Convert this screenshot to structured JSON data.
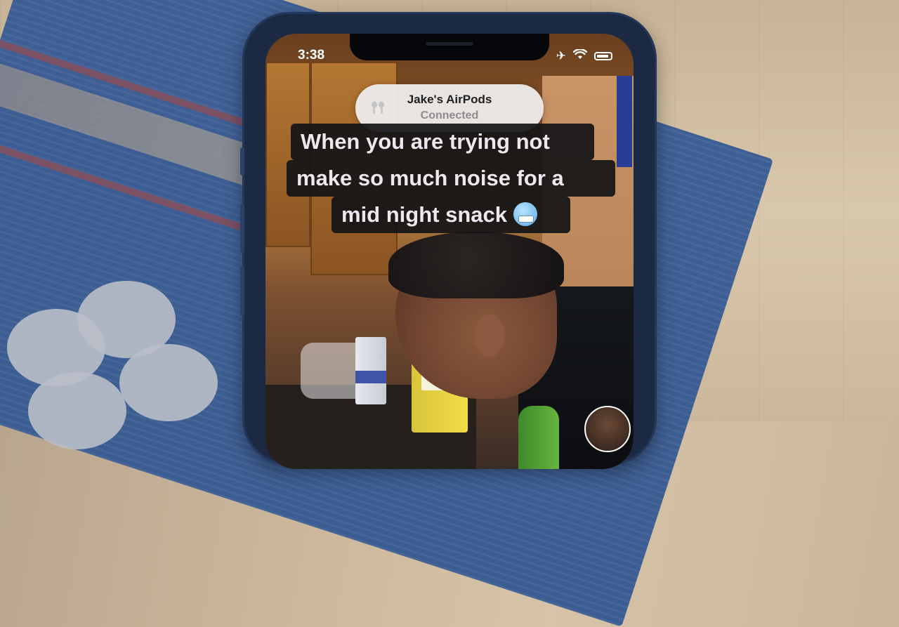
{
  "status_bar": {
    "time": "3:38",
    "icons": [
      "airplane-icon",
      "wifi-icon",
      "battery-icon"
    ]
  },
  "airpods_banner": {
    "device_name": "Jake's AirPods",
    "status": "Connected",
    "icon": "airpods-icon"
  },
  "caption": {
    "lines": [
      "When you are trying not",
      "make so much noise for a",
      "mid night snack"
    ],
    "emoji": "cold-face-emoji"
  },
  "colors": {
    "phone_frame": "#1b2a42",
    "banner_bg": "#eeeceb",
    "caption_bg": "#141416"
  }
}
